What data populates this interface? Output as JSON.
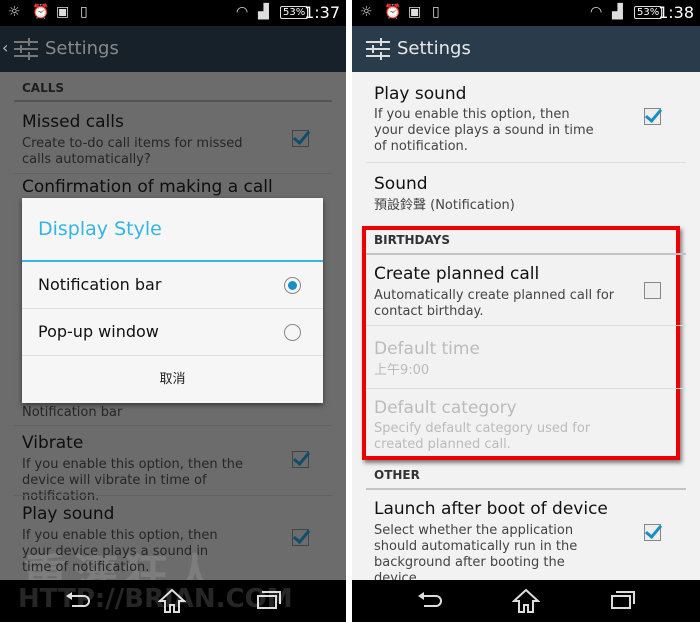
{
  "left": {
    "status": {
      "battery": "53%",
      "time": "1:37"
    },
    "appbar": {
      "title": "Settings"
    },
    "calls_header": "CALLS",
    "missed_calls": {
      "title": "Missed calls",
      "desc": "Create to-do call items for missed calls automatically?",
      "checked": true
    },
    "confirmation": {
      "title": "Confirmation of making a call"
    },
    "display_style_summary": "Notification bar",
    "vibrate": {
      "title": "Vibrate",
      "desc": "If you enable this option, then the device will vibrate in time of notification.",
      "checked": true
    },
    "play_sound": {
      "title": "Play sound",
      "desc": "If you enable this option, then your device plays a sound in time of notification.",
      "checked": true
    },
    "dialog": {
      "title": "Display Style",
      "options": [
        {
          "label": "Notification bar",
          "selected": true
        },
        {
          "label": "Pop-up window",
          "selected": false
        }
      ],
      "cancel": "取消"
    },
    "watermark": "重灌狂人 HTTP://BRIAN.COM"
  },
  "right": {
    "status": {
      "battery": "53%",
      "time": "1:38"
    },
    "appbar": {
      "title": "Settings"
    },
    "play_sound": {
      "title": "Play sound",
      "desc": "If you enable this option, then your device plays a sound in time of notification.",
      "checked": true
    },
    "sound": {
      "title": "Sound",
      "value": "預設鈴聲 (Notification)"
    },
    "birthdays_header": "BIRTHDAYS",
    "create_planned_call": {
      "title": "Create planned call",
      "desc": "Automatically create planned call for contact birthday.",
      "checked": false
    },
    "default_time": {
      "title": "Default time",
      "value": "上午9:00"
    },
    "default_category": {
      "title": "Default category",
      "desc": "Specify default category used for created planned call."
    },
    "other_header": "OTHER",
    "launch_after_boot": {
      "title": "Launch after boot of device",
      "desc": "Select whether the application should automatically run in the background after booting the device.",
      "checked": true
    }
  },
  "colors": {
    "accent": "#33b5e5",
    "checkbox": "#1a8fc6",
    "appbar": "#2a3c4b",
    "highlight": "#ee0000"
  }
}
